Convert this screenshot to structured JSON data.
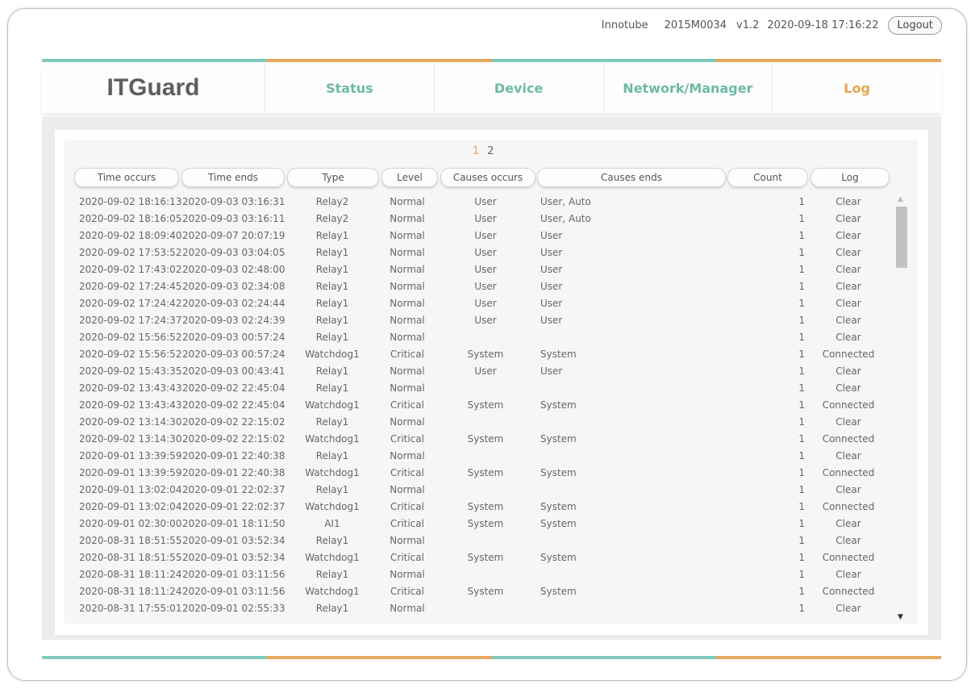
{
  "header": {
    "company": "Innotube",
    "serial": "2015M0034",
    "version": "v1.2",
    "datetime": "2020-09-18 17:16:22",
    "logout_label": "Logout"
  },
  "nav": {
    "logo": "ITGuard",
    "items": [
      {
        "label": "Status"
      },
      {
        "label": "Device"
      },
      {
        "label": "Network/Manager"
      },
      {
        "label": "Log"
      }
    ]
  },
  "pagination": {
    "current": "1",
    "next": "2"
  },
  "table": {
    "columns": [
      "Time occurs",
      "Time ends",
      "Type",
      "Level",
      "Causes occurs",
      "Causes ends",
      "Count",
      "Log"
    ],
    "rows": [
      [
        "2020-09-02 18:16:13",
        "2020-09-03 03:16:31",
        "Relay2",
        "Normal",
        "User",
        "User, Auto",
        "1",
        "Clear"
      ],
      [
        "2020-09-02 18:16:05",
        "2020-09-03 03:16:11",
        "Relay2",
        "Normal",
        "User",
        "User, Auto",
        "1",
        "Clear"
      ],
      [
        "2020-09-02 18:09:40",
        "2020-09-07 20:07:19",
        "Relay1",
        "Normal",
        "User",
        "User",
        "1",
        "Clear"
      ],
      [
        "2020-09-02 17:53:52",
        "2020-09-03 03:04:05",
        "Relay1",
        "Normal",
        "User",
        "User",
        "1",
        "Clear"
      ],
      [
        "2020-09-02 17:43:02",
        "2020-09-03 02:48:00",
        "Relay1",
        "Normal",
        "User",
        "User",
        "1",
        "Clear"
      ],
      [
        "2020-09-02 17:24:45",
        "2020-09-03 02:34:08",
        "Relay1",
        "Normal",
        "User",
        "User",
        "1",
        "Clear"
      ],
      [
        "2020-09-02 17:24:42",
        "2020-09-03 02:24:44",
        "Relay1",
        "Normal",
        "User",
        "User",
        "1",
        "Clear"
      ],
      [
        "2020-09-02 17:24:37",
        "2020-09-03 02:24:39",
        "Relay1",
        "Normal",
        "User",
        "User",
        "1",
        "Clear"
      ],
      [
        "2020-09-02 15:56:52",
        "2020-09-03 00:57:24",
        "Relay1",
        "Normal",
        "",
        "",
        "1",
        "Clear"
      ],
      [
        "2020-09-02 15:56:52",
        "2020-09-03 00:57:24",
        "Watchdog1",
        "Critical",
        "System",
        "System",
        "1",
        "Connected"
      ],
      [
        "2020-09-02 15:43:35",
        "2020-09-03 00:43:41",
        "Relay1",
        "Normal",
        "User",
        "User",
        "1",
        "Clear"
      ],
      [
        "2020-09-02 13:43:43",
        "2020-09-02 22:45:04",
        "Relay1",
        "Normal",
        "",
        "",
        "1",
        "Clear"
      ],
      [
        "2020-09-02 13:43:43",
        "2020-09-02 22:45:04",
        "Watchdog1",
        "Critical",
        "System",
        "System",
        "1",
        "Connected"
      ],
      [
        "2020-09-02 13:14:30",
        "2020-09-02 22:15:02",
        "Relay1",
        "Normal",
        "",
        "",
        "1",
        "Clear"
      ],
      [
        "2020-09-02 13:14:30",
        "2020-09-02 22:15:02",
        "Watchdog1",
        "Critical",
        "System",
        "System",
        "1",
        "Connected"
      ],
      [
        "2020-09-01 13:39:59",
        "2020-09-01 22:40:38",
        "Relay1",
        "Normal",
        "",
        "",
        "1",
        "Clear"
      ],
      [
        "2020-09-01 13:39:59",
        "2020-09-01 22:40:38",
        "Watchdog1",
        "Critical",
        "System",
        "System",
        "1",
        "Connected"
      ],
      [
        "2020-09-01 13:02:04",
        "2020-09-01 22:02:37",
        "Relay1",
        "Normal",
        "",
        "",
        "1",
        "Clear"
      ],
      [
        "2020-09-01 13:02:04",
        "2020-09-01 22:02:37",
        "Watchdog1",
        "Critical",
        "System",
        "System",
        "1",
        "Connected"
      ],
      [
        "2020-09-01 02:30:00",
        "2020-09-01 18:11:50",
        "AI1",
        "Critical",
        "System",
        "System",
        "1",
        "Clear"
      ],
      [
        "2020-08-31 18:51:55",
        "2020-09-01 03:52:34",
        "Relay1",
        "Normal",
        "",
        "",
        "1",
        "Clear"
      ],
      [
        "2020-08-31 18:51:55",
        "2020-09-01 03:52:34",
        "Watchdog1",
        "Critical",
        "System",
        "System",
        "1",
        "Connected"
      ],
      [
        "2020-08-31 18:11:24",
        "2020-09-01 03:11:56",
        "Relay1",
        "Normal",
        "",
        "",
        "1",
        "Clear"
      ],
      [
        "2020-08-31 18:11:24",
        "2020-09-01 03:11:56",
        "Watchdog1",
        "Critical",
        "System",
        "System",
        "1",
        "Connected"
      ],
      [
        "2020-08-31 17:55:01",
        "2020-09-01 02:55:33",
        "Relay1",
        "Normal",
        "",
        "",
        "1",
        "Clear"
      ]
    ]
  }
}
